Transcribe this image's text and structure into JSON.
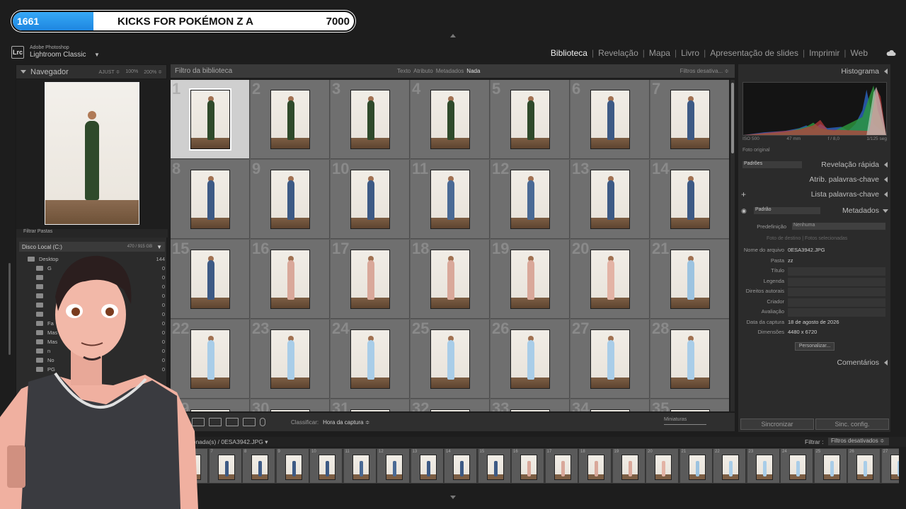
{
  "stream": {
    "count": "1661",
    "title": "KICKS FOR POKÉMON Z A",
    "goal": "7000",
    "progress": 0.237,
    "accent": "#2a95ea"
  },
  "app": {
    "logo": "Lrc",
    "brand_small": "Adobe Photoshop",
    "brand_main": "Lightroom Classic"
  },
  "modules": [
    "Biblioteca",
    "Revelação",
    "Mapa",
    "Livro",
    "Apresentação de slides",
    "Imprimir",
    "Web"
  ],
  "active_module": "Biblioteca",
  "navigator": {
    "title": "Navegador",
    "zoom": [
      "AJUST ≑",
      "100%",
      "200% ≑"
    ]
  },
  "folders": {
    "filter_label": "Filtrar Pastas",
    "volume": "Disco Local (C:)",
    "volume_capacity": "470 / 915 GB",
    "rows": [
      {
        "name": "Desktop",
        "count": "144"
      },
      {
        "name": "G",
        "count": "0"
      },
      {
        "name": "",
        "count": "0"
      },
      {
        "name": "",
        "count": "0"
      },
      {
        "name": "",
        "count": "0"
      },
      {
        "name": "",
        "count": "0"
      },
      {
        "name": "",
        "count": "0"
      },
      {
        "name": "Fa",
        "count": "0"
      },
      {
        "name": "Mas",
        "count": "0"
      },
      {
        "name": "Mas",
        "count": "0"
      },
      {
        "name": "n",
        "count": "0"
      },
      {
        "name": "No",
        "count": "0"
      },
      {
        "name": "PG",
        "count": "0"
      }
    ]
  },
  "library_filter": {
    "title": "Filtro da biblioteca",
    "tabs": [
      "Texto",
      "Atributo",
      "Metadados",
      "Nada"
    ],
    "active_tab": "Nada",
    "right": "Filtros desativa... ≑"
  },
  "grid": {
    "photos": [
      {
        "n": "1",
        "outfit": "#2f4a2b"
      },
      {
        "n": "2",
        "outfit": "#2f4a2b"
      },
      {
        "n": "3",
        "outfit": "#2f4a2b"
      },
      {
        "n": "4",
        "outfit": "#2f4a2b"
      },
      {
        "n": "5",
        "outfit": "#2f4a2b"
      },
      {
        "n": "6",
        "outfit": "#3d5a85"
      },
      {
        "n": "7",
        "outfit": "#3d5a85"
      },
      {
        "n": "8",
        "outfit": "#3d5a85"
      },
      {
        "n": "9",
        "outfit": "#3d5a85"
      },
      {
        "n": "10",
        "outfit": "#3d5a85"
      },
      {
        "n": "11",
        "outfit": "#4a6a95"
      },
      {
        "n": "12",
        "outfit": "#4a6a95"
      },
      {
        "n": "13",
        "outfit": "#3d5a85"
      },
      {
        "n": "14",
        "outfit": "#3d5a85"
      },
      {
        "n": "15",
        "outfit": "#3d5a85"
      },
      {
        "n": "16",
        "outfit": "#d9a89a"
      },
      {
        "n": "17",
        "outfit": "#d9a89a"
      },
      {
        "n": "18",
        "outfit": "#d9a89a"
      },
      {
        "n": "19",
        "outfit": "#d9a89a"
      },
      {
        "n": "20",
        "outfit": "#e3b3a5"
      },
      {
        "n": "21",
        "outfit": "#9cc3e0"
      },
      {
        "n": "22",
        "outfit": "#a9cde8"
      },
      {
        "n": "23",
        "outfit": "#a9cde8"
      },
      {
        "n": "24",
        "outfit": "#a9cde8"
      },
      {
        "n": "25",
        "outfit": "#a9cde8"
      },
      {
        "n": "26",
        "outfit": "#a9cde8"
      },
      {
        "n": "27",
        "outfit": "#a9cde8"
      },
      {
        "n": "28",
        "outfit": "#a9cde8"
      },
      {
        "n": "29",
        "outfit": "#a9cde8"
      },
      {
        "n": "30",
        "outfit": "#a9cde8"
      },
      {
        "n": "31",
        "outfit": "#a9cde8"
      },
      {
        "n": "32",
        "outfit": "#a9cde8"
      },
      {
        "n": "33",
        "outfit": "#a9cde8"
      },
      {
        "n": "34",
        "outfit": "#a9cde8"
      },
      {
        "n": "35",
        "outfit": "#a9cde8"
      }
    ],
    "selected_index": 0
  },
  "toolbar": {
    "sort_label": "Classificar:",
    "sort_value": "Hora da captura ≑",
    "thumb_label": "Miniaturas"
  },
  "right_panel": {
    "histogram": "Histograma",
    "hist_info": [
      "ISO 500",
      "47 mm",
      "f / 8,0",
      "1/125 seg"
    ],
    "original": "Foto original",
    "quick_develop": "Revelação rápida",
    "qd_preset": "Padrões",
    "keywording": "Atrib. palavras-chave",
    "keyword_list": "Lista palavras-chave",
    "metadata": "Metadados",
    "md_preset": "Padrão",
    "preset_label": "Predefinição",
    "preset_value": "Nenhuma",
    "subtabs": "Foto de destino    |    Fotos selecionadas",
    "fields": [
      {
        "label": "Nome do arquivo",
        "value": "0ESA3942.JPG"
      },
      {
        "label": "Pasta",
        "value": "zz"
      },
      {
        "label": "Título",
        "value": ""
      },
      {
        "label": "Legenda",
        "value": ""
      },
      {
        "label": "Direitos autorais",
        "value": ""
      },
      {
        "label": "Criador",
        "value": ""
      },
      {
        "label": "Avaliação",
        "value": ""
      },
      {
        "label": "Data da captura",
        "value": "18 de agosto de 2026"
      },
      {
        "label": "Dimensões",
        "value": "4480 x 6720"
      }
    ],
    "customize": "Personalizar...",
    "comments": "Comentários",
    "sync": "Sincronizar",
    "sync_settings": "Sinc. config."
  },
  "filmstrip": {
    "selection": "selecionada(s) / 0ESA3942.JPG ▾",
    "filter_label": "Filtrar :",
    "filter_value": "Filtros desativados ≑",
    "numbers": [
      "",
      "7",
      "8",
      "9",
      "10",
      "11",
      "12",
      "13",
      "14",
      "15",
      "16",
      "17",
      "18",
      "19",
      "20",
      "21",
      "22",
      "23",
      "24",
      "25",
      "26",
      "27"
    ],
    "colors": [
      "#2f4a2b",
      "#3d5a85",
      "#3d5a85",
      "#3d5a85",
      "#3d5a85",
      "#4a6a95",
      "#4a6a95",
      "#3d5a85",
      "#3d5a85",
      "#3d5a85",
      "#d9a89a",
      "#d9a89a",
      "#d9a89a",
      "#d9a89a",
      "#e3b3a5",
      "#9cc3e0",
      "#a9cde8",
      "#a9cde8",
      "#a9cde8",
      "#a9cde8",
      "#a9cde8",
      "#a9cde8"
    ]
  }
}
